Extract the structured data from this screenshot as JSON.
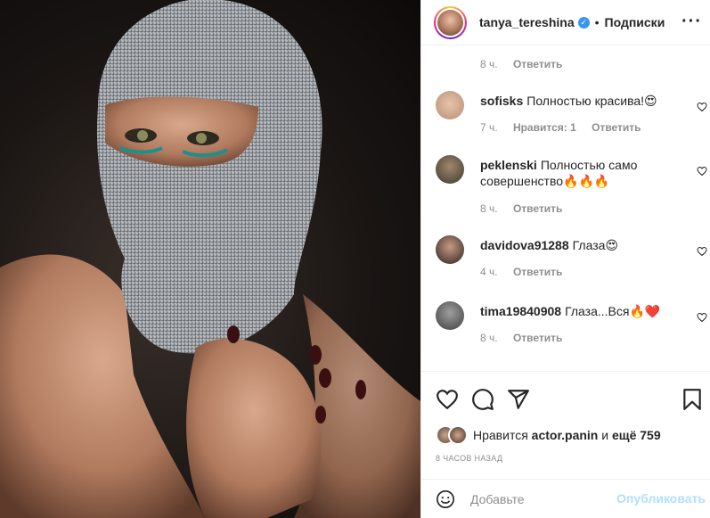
{
  "post": {
    "author": "tanya_tereshina",
    "dot": "•",
    "follow_label": "Подписки",
    "more_icon": "more-horizontal-icon"
  },
  "comments_area": {
    "top_time": "8 ч.",
    "reply_label": "Ответить",
    "items": [
      {
        "user": "sofisks",
        "text": "Полностью красива!😍",
        "time": "7 ч.",
        "likes": "Нравится: 1",
        "reply": "Ответить"
      },
      {
        "user": "peklenski",
        "text": "Полностью само совершенство🔥🔥🔥",
        "time": "8 ч.",
        "reply": "Ответить"
      },
      {
        "user": "davidova91288",
        "text": "Глаза😍",
        "time": "4 ч.",
        "reply": "Ответить"
      },
      {
        "user": "tima19840908",
        "text": "Глаза...Вся🔥❤️",
        "time": "8 ч.",
        "reply": "Ответить"
      }
    ]
  },
  "actions": {
    "liked_by_prefix": "Нравится",
    "liked_by_user": "actor.panin",
    "liked_by_and": "и",
    "liked_by_rest": "ещё 759",
    "time_ago": "8 часов назад"
  },
  "composer": {
    "placeholder": "Добавьте",
    "publish_label": "Опубликовать"
  },
  "colors": {
    "accent": "#3897f0",
    "publish_disabled": "#b2dffc",
    "muted": "#8e8e8e"
  }
}
